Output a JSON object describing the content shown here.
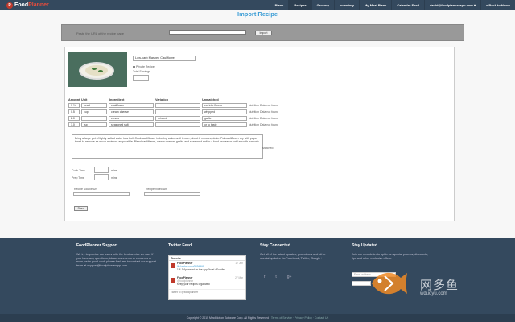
{
  "nav": {
    "logo_mark": "P",
    "logo_prefix": "Food",
    "logo_suffix": "Planner",
    "items": [
      {
        "label": "Plans",
        "active": false
      },
      {
        "label": "Recipes",
        "active": true
      },
      {
        "label": "Grocery",
        "active": false
      },
      {
        "label": "Inventory",
        "active": false
      },
      {
        "label": "My Meal Plans",
        "active": false
      },
      {
        "label": "Calendar Feed",
        "active": false
      },
      {
        "label": "david@foodplannerapp.com ▾",
        "active": false
      },
      {
        "label": "« Back to Home",
        "active": false
      }
    ]
  },
  "page": {
    "title": "Import Recipe"
  },
  "import_bar": {
    "label": "Paste the URL of the recipe page",
    "url_value": "",
    "button_label": "Import"
  },
  "recipe": {
    "name": "Low-carb Mashed Cauliflower",
    "private_label": "Private Recipe",
    "servings_label": "Total Servings",
    "servings_value": ""
  },
  "ingredients": {
    "headers": {
      "amount": "Amount",
      "unit": "Unit",
      "ingredient": "Ingredient",
      "variation": "Variation",
      "unmatched": "Unmatched"
    },
    "rows": [
      {
        "amount": "1 ½",
        "unit": "head",
        "ingredient": "cauliflower",
        "variation": "",
        "unmatched": "cut into florets",
        "status": "Nutrition Data not found"
      },
      {
        "amount": "0.5",
        "unit": "cup",
        "ingredient": "cream cheese",
        "variation": "",
        "unmatched": "whipped",
        "status": "Nutrition Data not found"
      },
      {
        "amount": "2.0",
        "unit": "",
        "ingredient": "cloves",
        "variation": "minced",
        "unmatched": "garlic",
        "status": "Nutrition Data not found"
      },
      {
        "amount": "1.0",
        "unit": "tsp",
        "ingredient": "seasoned salt",
        "variation": "",
        "unmatched": "or to taste",
        "status": "Nutrition Data not found"
      }
    ]
  },
  "directions": {
    "text": "Bring a large pot of lightly salted water to a boil. Cook cauliflower in boiling water until tender, about 8 minutes; drain. Pat cauliflower dry with paper towel to remove as much moisture as possible. Blend cauliflower, cream cheese, garlic, and seasoned salt in a food processor until smooth. smooth.",
    "matched_label": "Matched"
  },
  "times": {
    "cook_label": "Cook Time",
    "prep_label": "Prep Time",
    "unit": "mins",
    "cook_value": "",
    "prep_value": ""
  },
  "sources": {
    "recipe_label": "Recipe Source Url",
    "video_label": "Recipe Video Url",
    "recipe_value": "",
    "video_value": ""
  },
  "save_label": "Save",
  "footer": {
    "support": {
      "heading": "FoodPlanner Support",
      "text": "We try to provide our users with the best service we can. If you have any questions, ideas, comments or concerns or even just a good cook please feel free to contact our support team at support@foodplannerapp.com."
    },
    "twitter": {
      "heading": "Twitter Feed",
      "widget_title": "Tweets",
      "tweets": [
        {
          "user": "FoodPlanner",
          "handle": "@foodplanner",
          "time": "17 Jun",
          "text": "lifehacker.com/5934560",
          "extra": "1 & 1 Approved on the AppStore! #Foodie"
        },
        {
          "user": "FoodPlanner",
          "handle": "@foodplanner",
          "time": "27 Mar",
          "text": "Keep your recipes organized",
          "extra": ""
        }
      ],
      "footer": "Tweet to @foodplanner"
    },
    "connected": {
      "heading": "Stay Connected",
      "text": "Get all of the latest updates, promotions and other special updates via Facebook, Twitter, Google+"
    },
    "updated": {
      "heading": "Stay Updated",
      "text": "Join our newsletter to opt-in on special promos, discounts, tips and other exclusive offers.",
      "email_placeholder": "Email address"
    },
    "copyright": "Copyright © 2015 MindMotion Software Corp. All Rights Reserved",
    "links": "Terms of Service · Privacy Policy · Contact Us"
  },
  "watermark": {
    "text": "网多鱼",
    "url": "wduoyu.com"
  },
  "colors": {
    "nav": "#34495e",
    "accent": "#3d9ed6",
    "brand": "#c0392b"
  }
}
